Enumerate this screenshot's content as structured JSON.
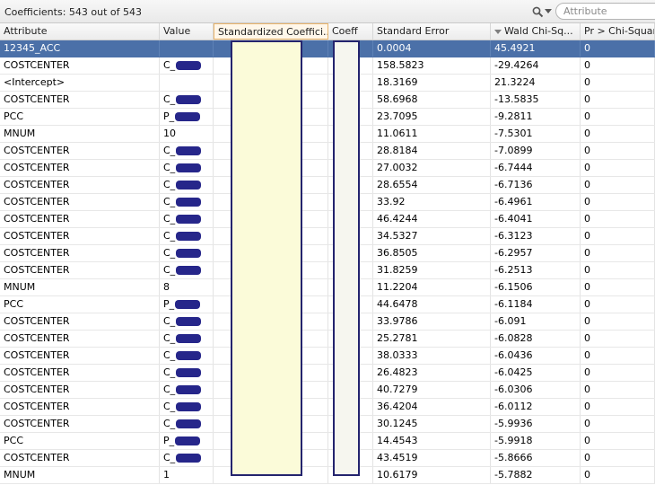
{
  "toolbar": {
    "title": "Coefficients: 543 out of 543",
    "search_placeholder": "Attribute",
    "icons": [
      "search-icon",
      "chevron-down-icon"
    ]
  },
  "columns": [
    {
      "key": "attr",
      "label": "Attribute"
    },
    {
      "key": "val",
      "label": "Value"
    },
    {
      "key": "std",
      "label": "Standardized Coeffici..."
    },
    {
      "key": "coeff",
      "label": "Coeff"
    },
    {
      "key": "se",
      "label": "Standard Error"
    },
    {
      "key": "wald",
      "label": "Wald Chi-Sq...",
      "sorted": "descending"
    },
    {
      "key": "pr",
      "label": "Pr > Chi-Square"
    }
  ],
  "colors": {
    "selection": "#4b70a8",
    "redaction": "#26268a",
    "mask_fill": "#fbfbd9"
  },
  "rows": [
    {
      "attr": "12345_ACC",
      "val": "",
      "se": "0.0004",
      "wald": "45.4921",
      "pr": "0",
      "selected": true
    },
    {
      "attr": "COSTCENTER",
      "val": "C_",
      "se": "158.5823",
      "wald": "-29.4264",
      "pr": "0",
      "redacted": true
    },
    {
      "attr": "<Intercept>",
      "val": "",
      "se": "18.3169",
      "wald": "21.3224",
      "pr": "0"
    },
    {
      "attr": "COSTCENTER",
      "val": "C_",
      "se": "58.6968",
      "wald": "-13.5835",
      "pr": "0",
      "redacted": true
    },
    {
      "attr": "PCC",
      "val": "P_",
      "se": "23.7095",
      "wald": "-9.2811",
      "pr": "0",
      "redacted": true
    },
    {
      "attr": "MNUM",
      "val": "10",
      "se": "11.0611",
      "wald": "-7.5301",
      "pr": "0"
    },
    {
      "attr": "COSTCENTER",
      "val": "C_",
      "se": "28.8184",
      "wald": "-7.0899",
      "pr": "0",
      "redacted": true
    },
    {
      "attr": "COSTCENTER",
      "val": "C_",
      "se": "27.0032",
      "wald": "-6.7444",
      "pr": "0",
      "redacted": true
    },
    {
      "attr": "COSTCENTER",
      "val": "C_",
      "se": "28.6554",
      "wald": "-6.7136",
      "pr": "0",
      "redacted": true
    },
    {
      "attr": "COSTCENTER",
      "val": "C_",
      "se": "33.92",
      "wald": "-6.4961",
      "pr": "0",
      "redacted": true
    },
    {
      "attr": "COSTCENTER",
      "val": "C_",
      "se": "46.4244",
      "wald": "-6.4041",
      "pr": "0",
      "redacted": true
    },
    {
      "attr": "COSTCENTER",
      "val": "C_",
      "se": "34.5327",
      "wald": "-6.3123",
      "pr": "0",
      "redacted": true
    },
    {
      "attr": "COSTCENTER",
      "val": "C_",
      "se": "36.8505",
      "wald": "-6.2957",
      "pr": "0",
      "redacted": true
    },
    {
      "attr": "COSTCENTER",
      "val": "C_",
      "se": "31.8259",
      "wald": "-6.2513",
      "pr": "0",
      "redacted": true
    },
    {
      "attr": "MNUM",
      "val": "8",
      "se": "11.2204",
      "wald": "-6.1506",
      "pr": "0"
    },
    {
      "attr": "PCC",
      "val": "P_",
      "se": "44.6478",
      "wald": "-6.1184",
      "pr": "0",
      "redacted": true
    },
    {
      "attr": "COSTCENTER",
      "val": "C_",
      "se": "33.9786",
      "wald": "-6.091",
      "pr": "0",
      "redacted": true
    },
    {
      "attr": "COSTCENTER",
      "val": "C_",
      "se": "25.2781",
      "wald": "-6.0828",
      "pr": "0",
      "redacted": true
    },
    {
      "attr": "COSTCENTER",
      "val": "C_",
      "se": "38.0333",
      "wald": "-6.0436",
      "pr": "0",
      "redacted": true
    },
    {
      "attr": "COSTCENTER",
      "val": "C_",
      "se": "26.4823",
      "wald": "-6.0425",
      "pr": "0",
      "redacted": true
    },
    {
      "attr": "COSTCENTER",
      "val": "C_",
      "se": "40.7279",
      "wald": "-6.0306",
      "pr": "0",
      "redacted": true
    },
    {
      "attr": "COSTCENTER",
      "val": "C_",
      "se": "36.4204",
      "wald": "-6.0112",
      "pr": "0",
      "redacted": true
    },
    {
      "attr": "COSTCENTER",
      "val": "C_",
      "se": "30.1245",
      "wald": "-5.9936",
      "pr": "0",
      "redacted": true
    },
    {
      "attr": "PCC",
      "val": "P_",
      "se": "14.4543",
      "wald": "-5.9918",
      "pr": "0",
      "redacted": true
    },
    {
      "attr": "COSTCENTER",
      "val": "C_",
      "se": "43.4519",
      "wald": "-5.8666",
      "pr": "0",
      "redacted": true
    },
    {
      "attr": "MNUM",
      "val": "1",
      "se": "10.6179",
      "wald": "-5.7882",
      "pr": "0"
    }
  ]
}
